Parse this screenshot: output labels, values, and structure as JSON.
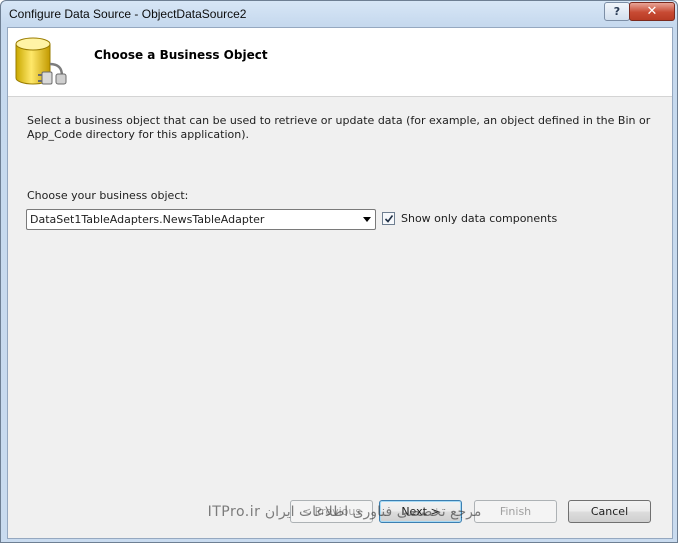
{
  "window": {
    "title": "Configure Data Source - ObjectDataSource2",
    "help_glyph": "?",
    "close_glyph": "✕"
  },
  "header": {
    "title": "Choose a Business Object",
    "icon": "database-plug-icon"
  },
  "body": {
    "description": "Select a business object that can be used to retrieve or update data (for example, an object defined in the Bin or App_Code directory for this application).",
    "choose_label": "Choose your business object:",
    "business_object_value": "DataSet1TableAdapters.NewsTableAdapter",
    "show_only_data_components": {
      "label": "Show only data components",
      "checked": true
    }
  },
  "footer": {
    "previous_label": "< Previous",
    "next_label": "Next >",
    "finish_label": "Finish",
    "cancel_label": "Cancel"
  },
  "watermark": "مرجع تخصصی فناوری اطلاعات ایران ITPro.ir"
}
